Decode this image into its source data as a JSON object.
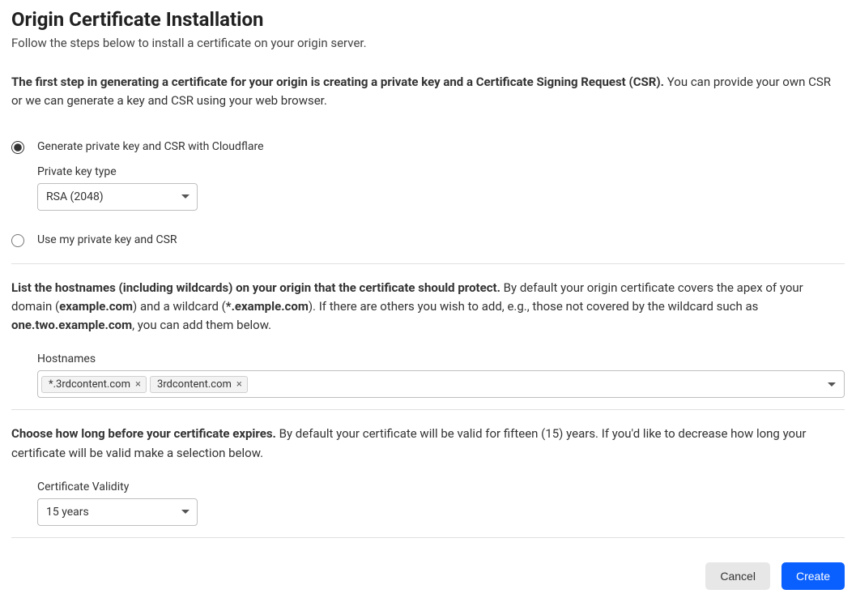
{
  "header": {
    "title": "Origin Certificate Installation",
    "subtitle": "Follow the steps below to install a certificate on your origin server."
  },
  "step1": {
    "intro_bold": "The first step in generating a certificate for your origin is creating a private key and a Certificate Signing Request (CSR).",
    "intro_rest": " You can provide your own CSR or we can generate a key and CSR using your web browser.",
    "option_generate": "Generate private key and CSR with Cloudflare",
    "private_key_type_label": "Private key type",
    "private_key_type_value": "RSA (2048)",
    "option_own": "Use my private key and CSR"
  },
  "step2": {
    "text_bold": "List the hostnames (including wildcards) on your origin that the certificate should protect.",
    "text_part1": " By default your origin certificate covers the apex of your domain (",
    "example1": "example.com",
    "text_part2": ") and a wildcard (",
    "example2": "*.example.com",
    "text_part3": "). If there are others you wish to add, e.g., those not covered by the wildcard such as ",
    "example3": "one.two.example.com",
    "text_part4": ", you can add them below.",
    "hostnames_label": "Hostnames",
    "hosts": [
      "*.3rdcontent.com",
      "3rdcontent.com"
    ]
  },
  "step3": {
    "text_bold": "Choose how long before your certificate expires.",
    "text_rest": " By default your certificate will be valid for fifteen (15) years. If you'd like to decrease how long your certificate will be valid make a selection below.",
    "validity_label": "Certificate Validity",
    "validity_value": "15 years"
  },
  "footer": {
    "cancel": "Cancel",
    "create": "Create"
  }
}
